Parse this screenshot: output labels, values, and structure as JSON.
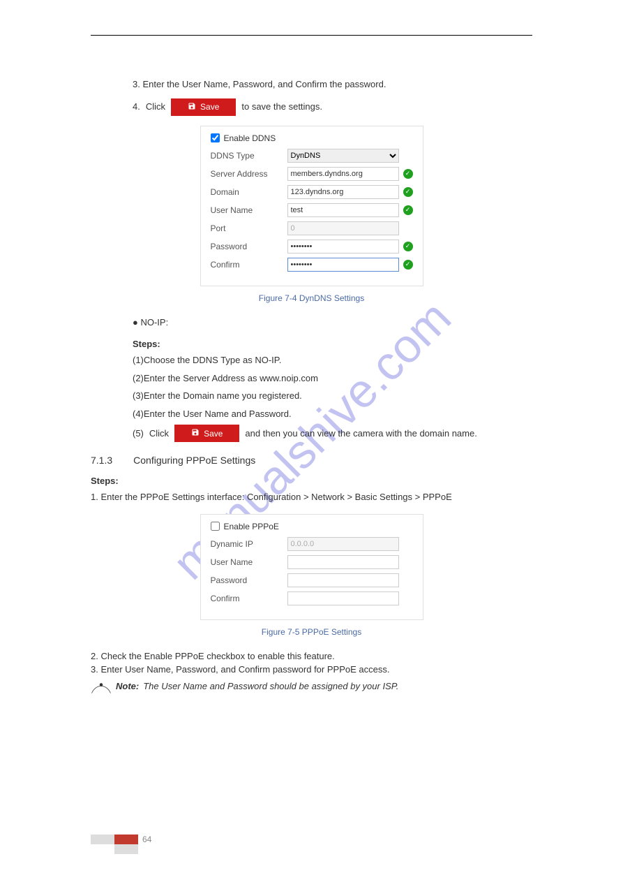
{
  "watermark": "manualshive.com",
  "step3": {
    "num": "3.",
    "text": "Enter the User Name, Password, and Confirm the password."
  },
  "save_label": "Save",
  "step4_prefix": "4.",
  "step4_a": "Click",
  "step4_b": "to save the settings.",
  "ddns_panel": {
    "enable_label": "Enable DDNS",
    "enable_checked": true,
    "rows": {
      "type_label": "DDNS Type",
      "type_value": "DynDNS",
      "server_label": "Server Address",
      "server_value": "members.dyndns.org",
      "domain_label": "Domain",
      "domain_value": "123.dyndns.org",
      "user_label": "User Name",
      "user_value": "test",
      "port_label": "Port",
      "port_value": "0",
      "pass_label": "Password",
      "pass_value": "••••••••",
      "confirm_label": "Confirm",
      "confirm_value": "••••••••"
    }
  },
  "figure1_caption": "Figure 7-4 DynDNS Settings",
  "no_ip": {
    "heading": "NO-IP:",
    "steps": {
      "s1": "Choose the DDNS Type as NO-IP.",
      "s2": "Enter the Server Address as www.noip.com",
      "s3": "Enter the Domain name you registered.",
      "s4": "Enter the User Name and Password.",
      "s5_a": "Click",
      "s5_b": "and then you can view the camera with the domain name."
    }
  },
  "sect": {
    "num": "7.1.3",
    "title": "Configuring PPPoE Settings"
  },
  "steps_label": "Steps:",
  "pppoe_step1": "1. Enter the PPPoE Settings interface: Configuration > Network > Basic Settings > PPPoE",
  "pppoe_panel": {
    "enable_label": "Enable PPPoE",
    "enable_checked": false,
    "rows": {
      "dynip_label": "Dynamic IP",
      "dynip_value": "0.0.0.0",
      "user_label": "User Name",
      "pass_label": "Password",
      "confirm_label": "Confirm"
    }
  },
  "figure2_caption": "Figure 7-5 PPPoE Settings",
  "pppoe_step2": "2. Check the Enable PPPoE checkbox to enable this feature.",
  "pppoe_step3": "3. Enter User Name, Password, and Confirm password for PPPoE access.",
  "note_label": "Note:",
  "note_text": "The User Name and Password should be assigned by your ISP.",
  "page_number": "64"
}
